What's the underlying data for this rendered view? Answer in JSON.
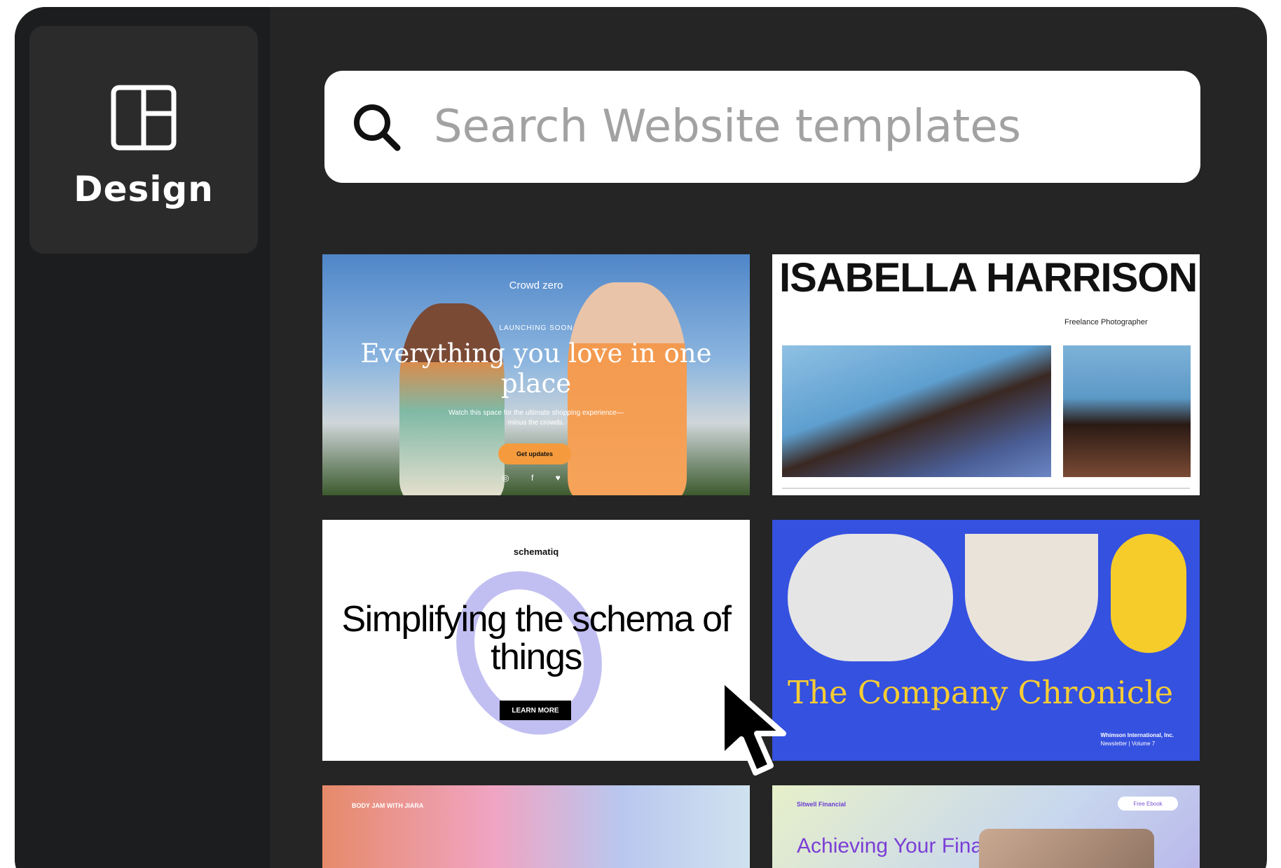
{
  "sidebar": {
    "design_label": "Design",
    "design_icon": "layout-icon"
  },
  "search": {
    "placeholder": "Search Website templates",
    "icon": "search-icon"
  },
  "templates": [
    {
      "brand": "Crowd zero",
      "kicker": "LAUNCHING SOON",
      "headline": "Everything you love in one place",
      "subtext": "Watch this space for the ultimate shopping experience—minus the crowds.",
      "cta": "Get updates"
    },
    {
      "name": "ISABELLA HARRISON",
      "role": "Freelance Photographer"
    },
    {
      "logo": "schematiq",
      "headline": "Simplifying the schema of things",
      "cta": "LEARN MORE"
    },
    {
      "title": "The Company Chronicle",
      "meta_line1": "Whimson International, Inc.",
      "meta_line2": "Newsletter | Volume 7"
    },
    {
      "tag": "BODY JAM WITH JIARA"
    },
    {
      "brand": "Sitwell Financial",
      "cta": "Free Ebook",
      "headline": "Achieving Your Financial Goals"
    }
  ],
  "colors": {
    "app_background": "#252525",
    "sidebar_background": "#1b1d1e",
    "design_tab_background": "#2b2b2b",
    "search_placeholder": "#a2a2a2",
    "chronicle_blue": "#3551e0",
    "chronicle_yellow": "#f7cd32"
  }
}
